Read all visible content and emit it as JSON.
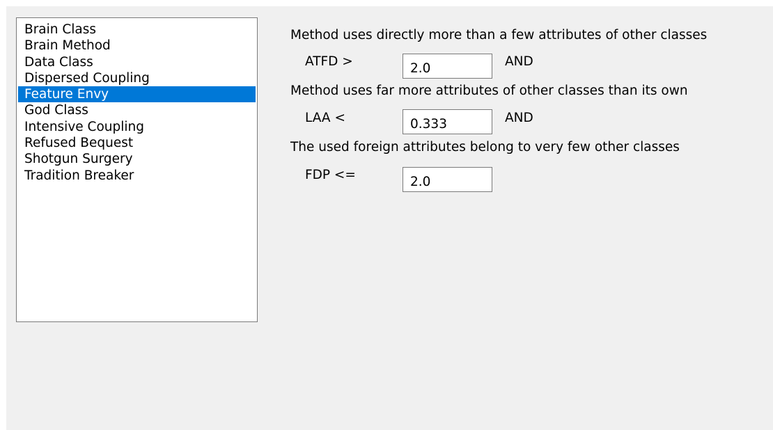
{
  "smell_list": {
    "items": [
      {
        "label": "Brain Class"
      },
      {
        "label": "Brain Method"
      },
      {
        "label": "Data Class"
      },
      {
        "label": "Dispersed Coupling"
      },
      {
        "label": "Feature Envy"
      },
      {
        "label": "God Class"
      },
      {
        "label": "Intensive Coupling"
      },
      {
        "label": "Refused Bequest"
      },
      {
        "label": "Shotgun Surgery"
      },
      {
        "label": "Tradition Breaker"
      }
    ],
    "selected_label": "Feature Envy",
    "selection_color": "#0078d7"
  },
  "criteria": [
    {
      "description": "Method uses directly more than a few attributes of other classes",
      "metric": "ATFD >",
      "value": "2.0",
      "connector": "AND"
    },
    {
      "description": "Method uses far more attributes of other classes than its own",
      "metric": "LAA <",
      "value": "0.333",
      "connector": "AND"
    },
    {
      "description": "The used foreign attributes belong to very few other classes",
      "metric": "FDP <=",
      "value": "2.0",
      "connector": ""
    }
  ]
}
